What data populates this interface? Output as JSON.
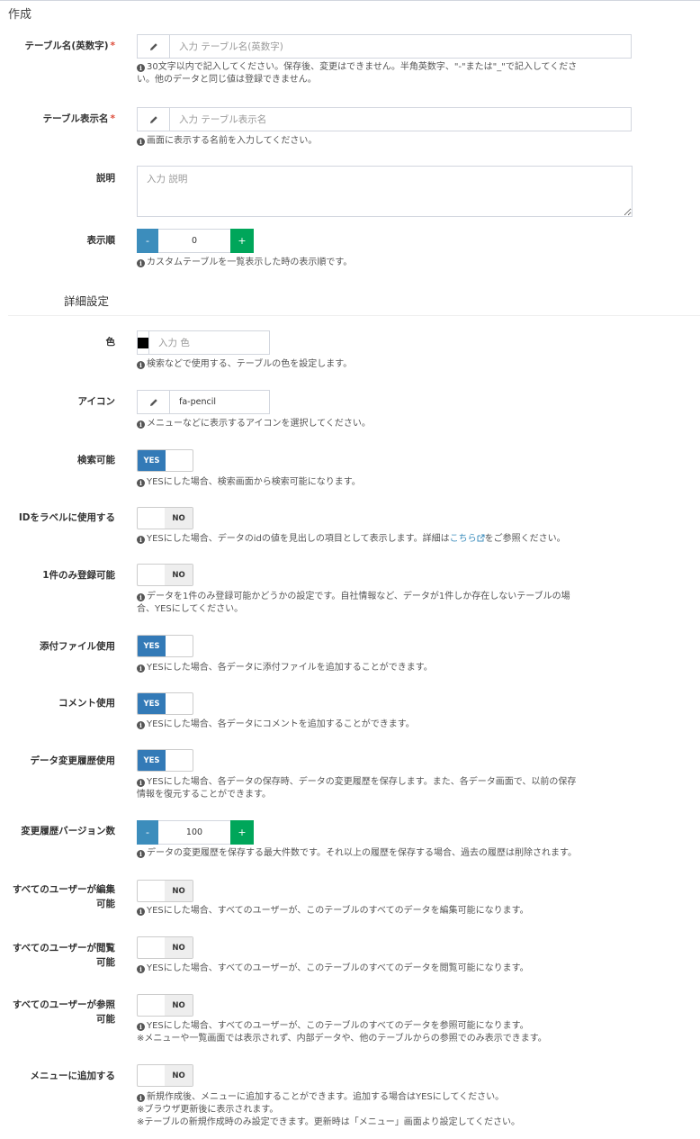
{
  "box_title": "作成",
  "fields": {
    "table_name": {
      "label": "テーブル名(英数字)",
      "required_mark": "*",
      "placeholder": "入力 テーブル名(英数字)",
      "value": "",
      "help_1": "30文字以内で記入してください。保存後、変更はできません。半角英数字、\"-\"または\"_\"で記入してくださ",
      "help_2": "い。他のデータと同じ値は登録できません。"
    },
    "table_view_name": {
      "label": "テーブル表示名",
      "required_mark": "*",
      "placeholder": "入力 テーブル表示名",
      "value": "",
      "help": "画面に表示する名前を入力してください。"
    },
    "description": {
      "label": "説明",
      "placeholder": "入力 説明"
    },
    "order": {
      "label": "表示順",
      "minus": "-",
      "plus": "+",
      "value": "0",
      "help": "カスタムテーブルを一覧表示した時の表示順です。"
    }
  },
  "detail_heading": "詳細設定",
  "detail": {
    "color": {
      "label": "色",
      "placeholder": "入力 色",
      "swatch_color": "#000000",
      "help": "検索などで使用する、テーブルの色を設定します。"
    },
    "icon": {
      "label": "アイコン",
      "value": "fa-pencil",
      "help": "メニューなどに表示するアイコンを選択してください。"
    },
    "searchable": {
      "label": "検索可能",
      "state": "YES",
      "help": "YESにした場合、検索画面から検索可能になります。"
    },
    "id_label": {
      "label": "IDをラベルに使用する",
      "state": "NO",
      "help_pre": "YESにした場合、データのidの値を見出しの項目として表示します。詳細は",
      "help_link": "こちら",
      "help_post": "をご参照ください。"
    },
    "one_record": {
      "label": "1件のみ登録可能",
      "state": "NO",
      "help_1": "データを1件のみ登録可能かどうかの設定です。自社情報など、データが1件しか存在しないテーブルの場",
      "help_2": "合、YESにしてください。"
    },
    "attachment": {
      "label": "添付ファイル使用",
      "state": "YES",
      "help": "YESにした場合、各データに添付ファイルを追加することができます。"
    },
    "comment": {
      "label": "コメント使用",
      "state": "YES",
      "help": "YESにした場合、各データにコメントを追加することができます。"
    },
    "revision": {
      "label": "データ変更履歴使用",
      "state": "YES",
      "help_1": "YESにした場合、各データの保存時、データの変更履歴を保存します。また、各データ画面で、以前の保存",
      "help_2": "情報を復元することができます。"
    },
    "revision_count": {
      "label": "変更履歴バージョン数",
      "minus": "-",
      "plus": "+",
      "value": "100",
      "help": "データの変更履歴を保存する最大件数です。それ以上の履歴を保存する場合、過去の履歴は削除されます。"
    },
    "all_edit": {
      "label": "すべてのユーザーが編集可能",
      "state": "NO",
      "help": "YESにした場合、すべてのユーザーが、このテーブルのすべてのデータを編集可能になります。"
    },
    "all_view": {
      "label": "すべてのユーザーが閲覧可能",
      "state": "NO",
      "help": "YESにした場合、すべてのユーザーが、このテーブルのすべてのデータを閲覧可能になります。"
    },
    "all_reference": {
      "label": "すべてのユーザーが参照可能",
      "state": "NO",
      "help_1": "YESにした場合、すべてのユーザーが、このテーブルのすべてのデータを参照可能になります。",
      "help_2": "※メニューや一覧画面では表示されず、内部データや、他のテーブルからの参照でのみ表示できます。"
    },
    "add_menu": {
      "label": "メニューに追加する",
      "state": "NO",
      "help_1": "新規作成後、メニューに追加することができます。追加する場合はYESにしてください。",
      "help_2": "※ブラウザ更新後に表示されます。",
      "help_3": "※テーブルの新規作成時のみ設定できます。更新時は「メニュー」画面より設定してください。"
    }
  }
}
